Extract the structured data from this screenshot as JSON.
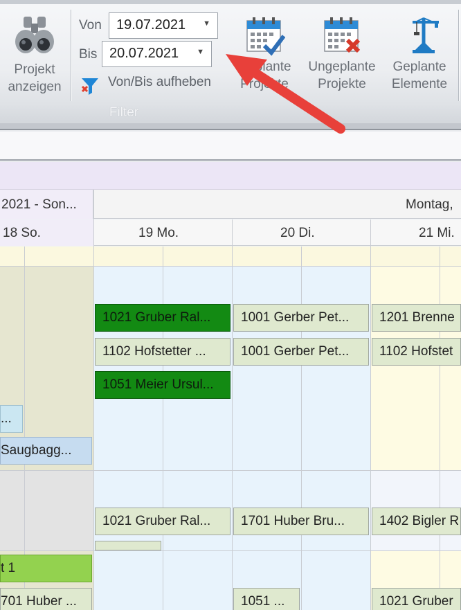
{
  "ribbon": {
    "projekt_button": {
      "line1": "Projekt",
      "line2": "anzeigen",
      "icon": "binoculars-icon"
    },
    "filter": {
      "from_label": "Von",
      "from_value": "19.07.2021",
      "to_label": "Bis",
      "to_value": "20.07.2021",
      "clear_label": "Von/Bis aufheben",
      "group_caption": "Filter"
    },
    "buttons": [
      {
        "line1": "Geplante",
        "line2": "Projekte",
        "icon": "calendar-check-icon"
      },
      {
        "line1": "Ungeplante",
        "line2": "Projekte",
        "icon": "calendar-x-icon"
      },
      {
        "line1": "Geplante",
        "line2": "Elemente",
        "icon": "crane-icon"
      }
    ],
    "colors": {
      "calendar_blue": "#2e8bd6",
      "check_blue": "#2f6fb6",
      "x_red": "#d63a2a",
      "crane_blue": "#1f7bc4"
    }
  },
  "scheduler": {
    "week_headers": [
      "2021 - Son...",
      "Montag,"
    ],
    "day_headers": [
      "18 So.",
      "19 Mo.",
      "20 Di.",
      "21 Mi."
    ],
    "appointments": {
      "mo_1": "1021 Gruber Ral...",
      "di_1": "1001 Gerber Pet...",
      "mi_1": "1201 Brenne",
      "mo_2": "1102 Hofstetter ...",
      "di_2": "1001 Gerber Pet...",
      "mi_2": "1102 Hofstet",
      "mo_3": "1051 Meier Ursul...",
      "so_1": "...",
      "so_2": "Saugbagg...",
      "mo_4": "1021 Gruber Ral...",
      "di_4": "1701 Huber Bru...",
      "mi_4": "1402 Bigler R",
      "so_3": "t 1",
      "so_4": "701 Huber ...",
      "di_5": "1051 ...",
      "mi_5": "1021 Gruber"
    },
    "colors": {
      "green": "#138a13",
      "light_green": "#dfe9cf",
      "weekday_bg": "#e8f3fc",
      "sunday_bg": "#e6e6d0",
      "yellow_bg": "#fefbe3",
      "lime": "#93d24f"
    }
  },
  "annotation": {
    "arrow_color": "#e8403a"
  }
}
